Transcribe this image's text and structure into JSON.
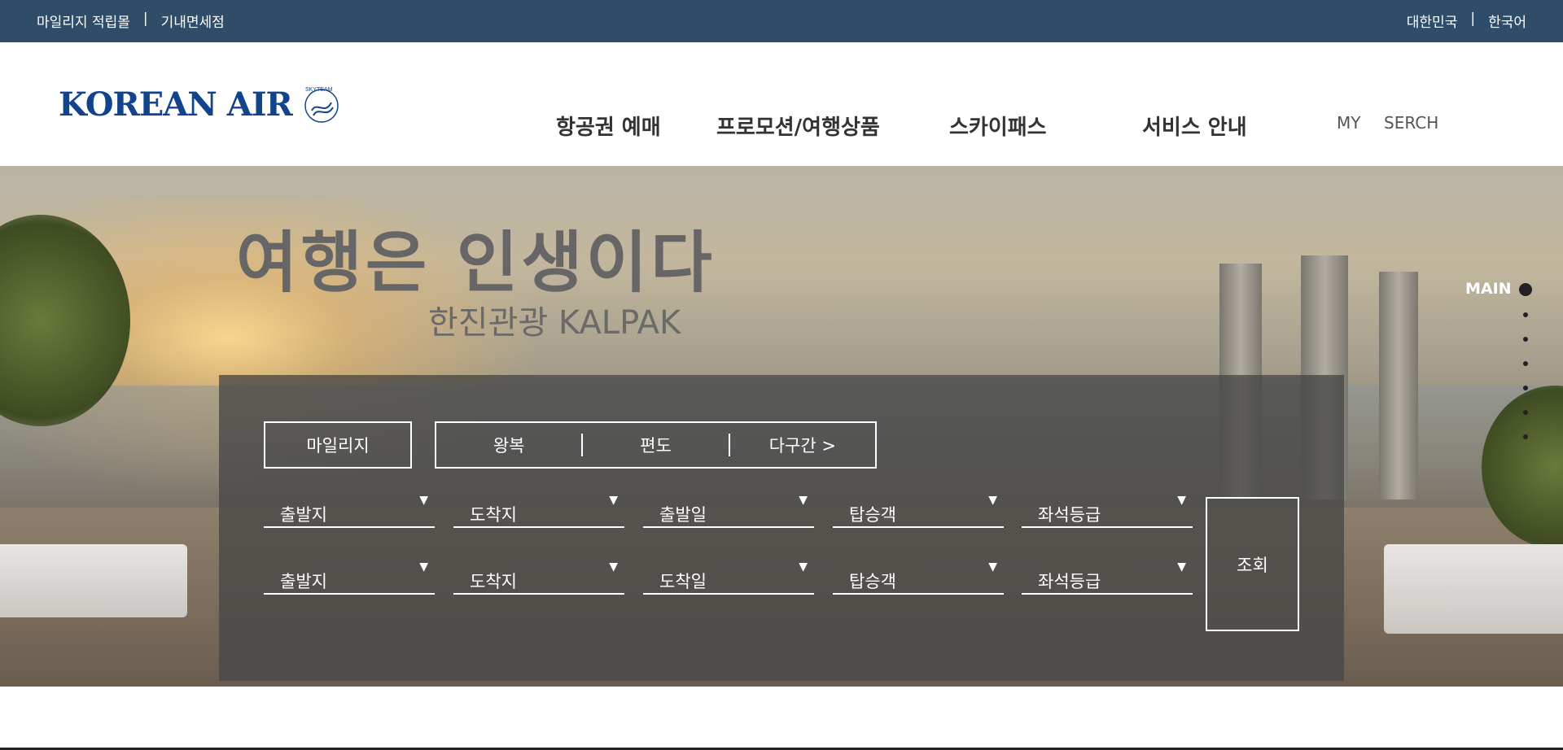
{
  "topbar": {
    "links_left": [
      "마일리지 적립몰",
      "|",
      "기내면세점"
    ],
    "links_right": [
      "대한민국",
      "|",
      "한국어"
    ],
    "background_color": "#2f4d68"
  },
  "header": {
    "logo_text": "KOREAN AIR",
    "logo_sub": "SKYTEAM",
    "nav": [
      "항공권 예매",
      "프로모션/여행상품",
      "스카이패스",
      "서비스 안내"
    ],
    "util_my": "MY",
    "util_serch": "SERCH"
  },
  "hero": {
    "title": "여행은 인생이다",
    "subtitle": "한진관광 KALPAK",
    "pager_label": "MAIN"
  },
  "search": {
    "tab_mileage": "마일리지",
    "trip_types": [
      "왕복",
      "편도",
      "다구간 >"
    ],
    "row1": [
      "출발지",
      "도착지",
      "출발일",
      "탑승객",
      "좌석등급"
    ],
    "row2": [
      "출발지",
      "도착지",
      "도착일",
      "탑승객",
      "좌석등급"
    ],
    "caret": "▼",
    "submit_label": "조회"
  },
  "colors": {
    "brand": "#12438c",
    "panel": "rgba(70,70,70,0.78)"
  }
}
